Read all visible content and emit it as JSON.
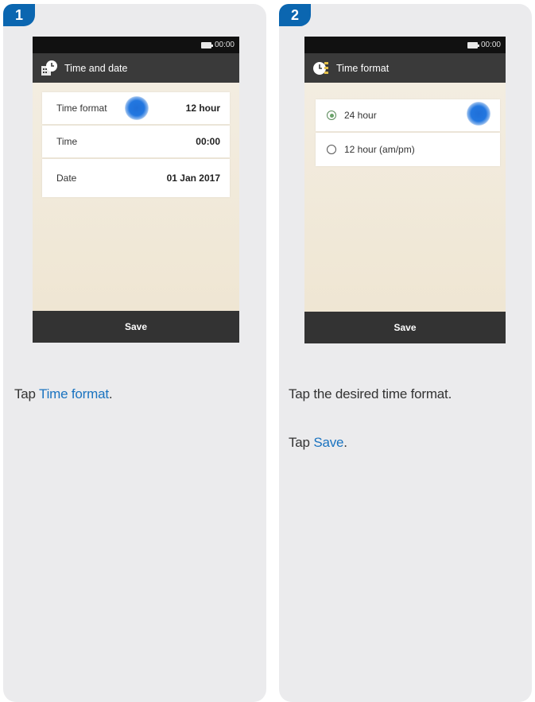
{
  "step1": {
    "badge": "1",
    "status_time": "00:00",
    "title": "Time and date",
    "rows": [
      {
        "label": "Time format",
        "value": "12 hour"
      },
      {
        "label": "Time",
        "value": "00:00"
      },
      {
        "label": "Date",
        "value": "01 Jan 2017"
      }
    ],
    "save_label": "Save",
    "caption_prefix": "Tap ",
    "caption_link": "Time format",
    "caption_suffix": "."
  },
  "step2": {
    "badge": "2",
    "status_time": "00:00",
    "title": "Time format",
    "options": [
      {
        "label": "24 hour",
        "selected": true
      },
      {
        "label": "12 hour (am/pm)",
        "selected": false
      }
    ],
    "save_label": "Save",
    "caption_line1": "Tap the desired time format.",
    "caption2_prefix": "Tap ",
    "caption2_link": "Save",
    "caption2_suffix": "."
  },
  "colors": {
    "accent_blue": "#0b66b0",
    "link_blue": "#1a73c0",
    "panel_bg": "#ebebed",
    "screen_bg": "#f4eee2",
    "touch_indicator": "#2277e0"
  },
  "icons": {
    "step1_title_icon": "clock-calendar-icon",
    "step2_title_icon": "time-format-icon",
    "status_icon": "battery-icon"
  }
}
